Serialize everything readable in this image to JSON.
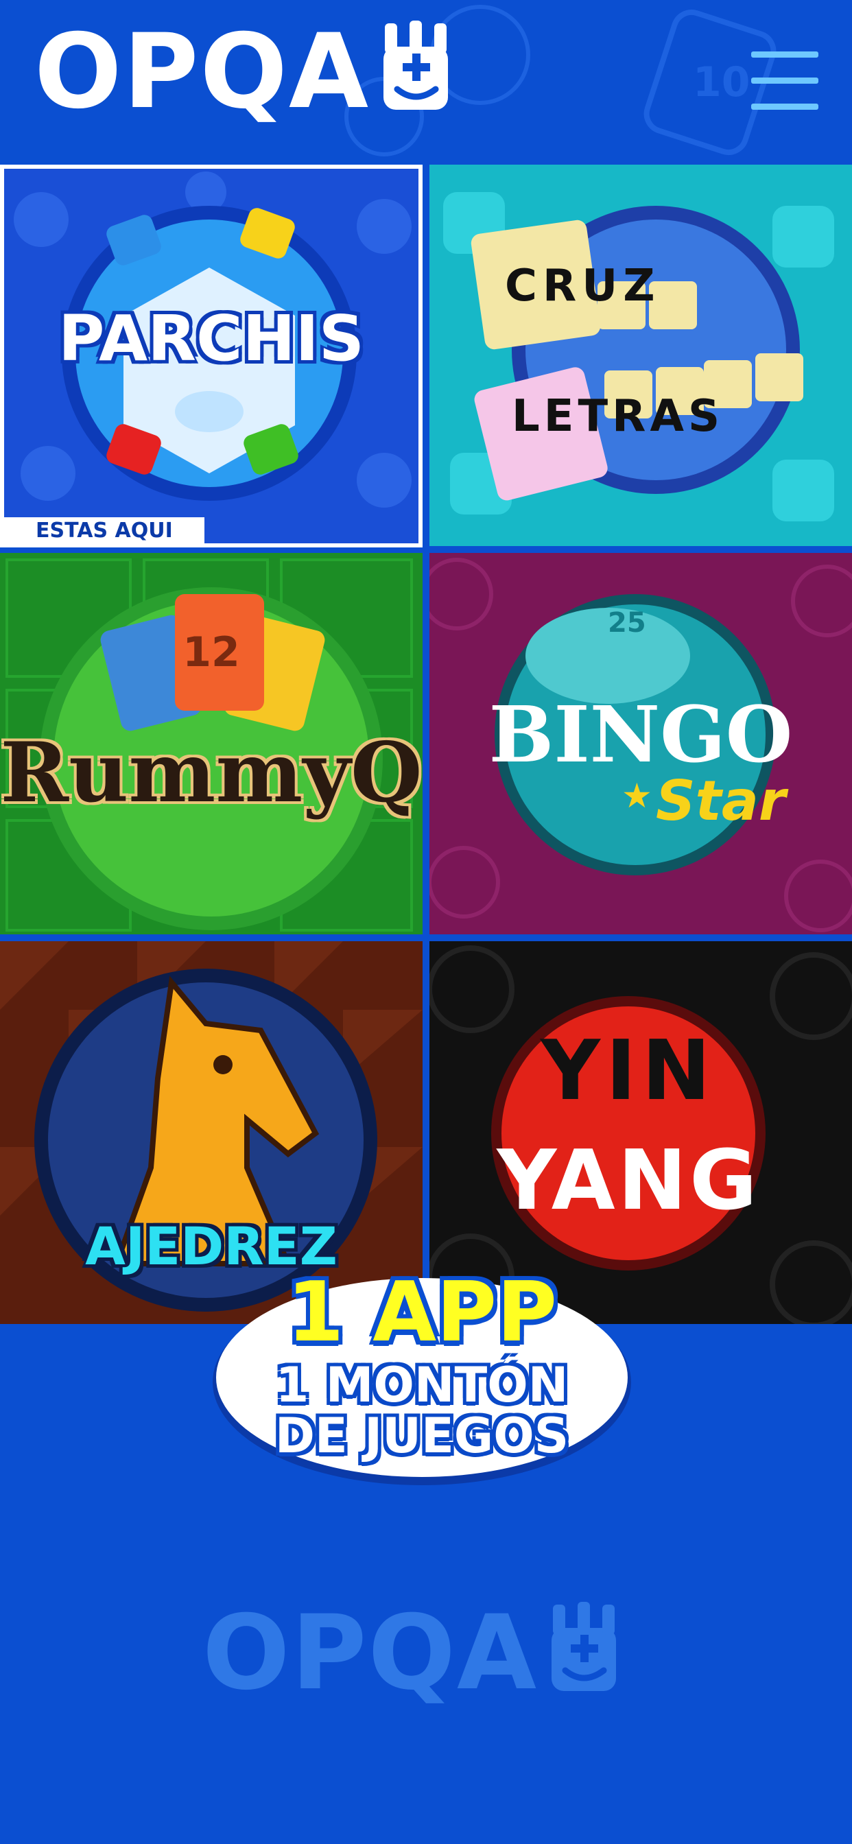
{
  "brand": {
    "logo_text": "OPQA"
  },
  "header": {
    "menu_icon": "hamburger-menu-icon"
  },
  "games": [
    {
      "id": "parchis",
      "title": "PARCHIS",
      "active": true,
      "badge": "ESTAS AQUI"
    },
    {
      "id": "cruzletras",
      "title_line1": "CRUZ",
      "title_line2": "LETRAS"
    },
    {
      "id": "rummyq",
      "title": "RummyQ",
      "card_number": "12"
    },
    {
      "id": "bingo",
      "title": "BINGO",
      "subtitle": "Star"
    },
    {
      "id": "ajedrez",
      "title": "AJEDREZ"
    },
    {
      "id": "yinyang",
      "title_line1": "YIN",
      "title_line2": "YANG"
    }
  ],
  "promo": {
    "line1": "1 APP",
    "line2": "1 MONTÓN",
    "line3": "DE JUEGOS"
  },
  "footer": {
    "logo_text": "OPQA"
  },
  "colors": {
    "background": "#0b4fd1",
    "accent_yellow": "#ffff22",
    "menu": "#6ec8ff"
  }
}
